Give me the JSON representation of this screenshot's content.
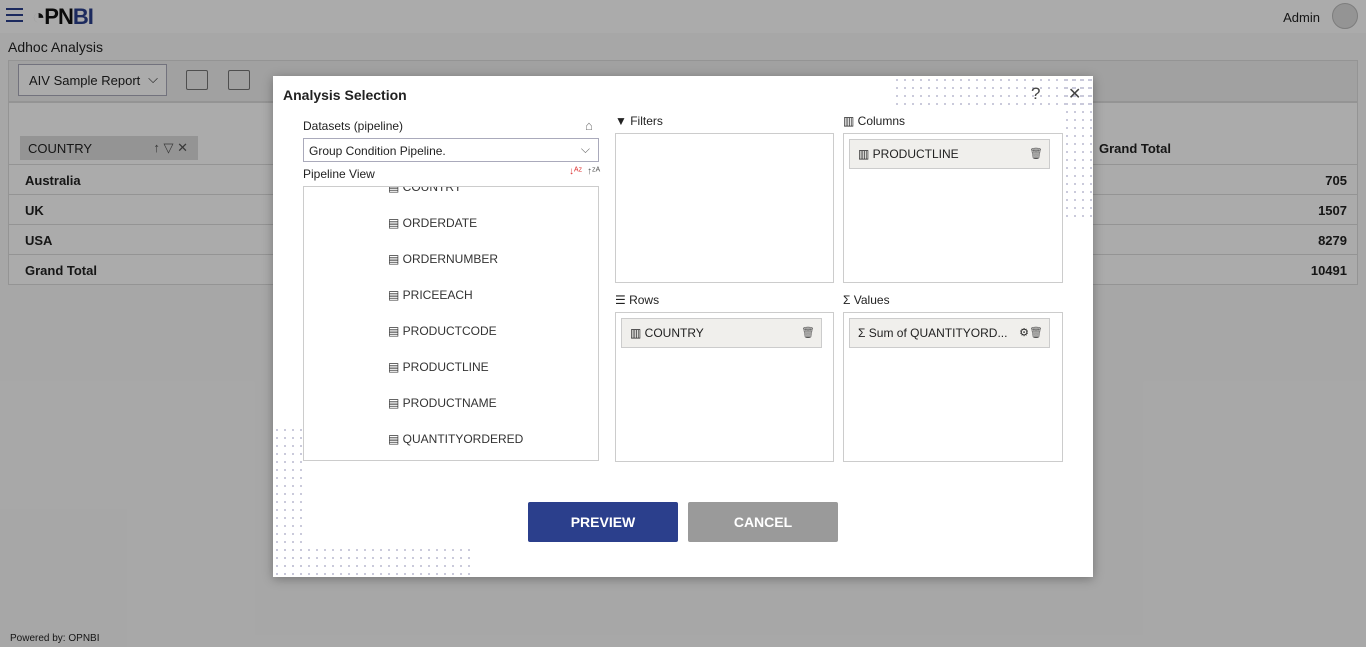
{
  "header": {
    "logo": "OPNBI",
    "user": "Admin"
  },
  "page": {
    "title": "Adhoc Analysis",
    "report_select": "AIV Sample Report"
  },
  "pivot": {
    "row_field": "COUNTRY",
    "grand_total_header": "Grand Total",
    "rows": [
      {
        "label": "Australia",
        "value": "705"
      },
      {
        "label": "UK",
        "value": "1507"
      },
      {
        "label": "USA",
        "value": "8279"
      },
      {
        "label": "Grand Total",
        "value": "10491"
      }
    ]
  },
  "footer": "Powered by: OPNBI",
  "modal": {
    "title": "Analysis Selection",
    "datasets_label": "Datasets (pipeline)",
    "dataset_value": "Group Condition Pipeline.",
    "pipeline_view_label": "Pipeline View",
    "fields": [
      "COUNTRY",
      "ORDERDATE",
      "ORDERNUMBER",
      "PRICEEACH",
      "PRODUCTCODE",
      "PRODUCTLINE",
      "PRODUCTNAME",
      "QUANTITYORDERED"
    ],
    "filters_label": "Filters",
    "columns_label": "Columns",
    "rows_label": "Rows",
    "values_label": "Values",
    "columns": [
      "PRODUCTLINE"
    ],
    "rows": [
      "COUNTRY"
    ],
    "values": [
      "Sum of QUANTITYORD..."
    ],
    "preview": "PREVIEW",
    "cancel": "CANCEL",
    "help": "?",
    "close": "✕"
  },
  "colors": {
    "brand": "#2b3f8c",
    "preview": "#2b3f8c",
    "cancel": "#9a9a9a"
  }
}
